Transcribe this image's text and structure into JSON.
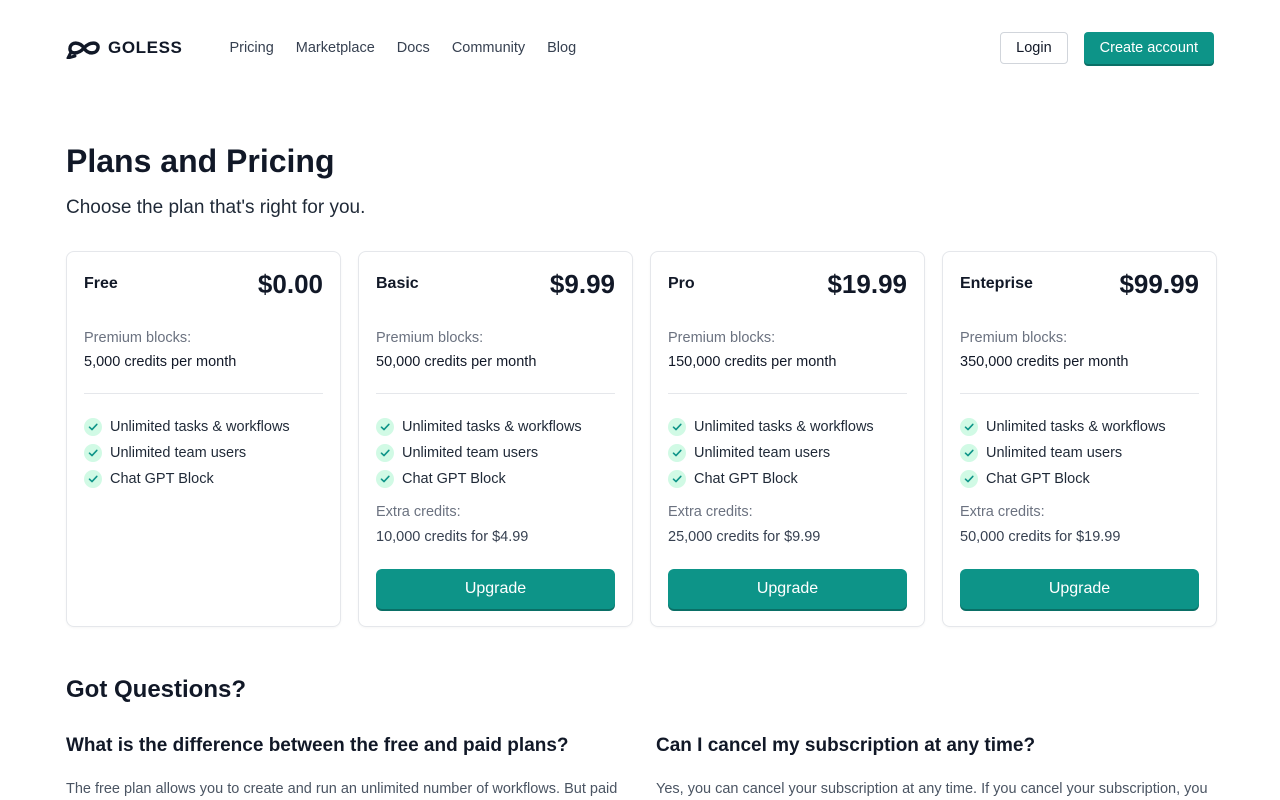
{
  "header": {
    "logo_text": "GOLESS",
    "nav": [
      "Pricing",
      "Marketplace",
      "Docs",
      "Community",
      "Blog"
    ],
    "login_label": "Login",
    "create_label": "Create account",
    "accent_color": "#0d9488"
  },
  "hero": {
    "title": "Plans and Pricing",
    "subtitle": "Choose the plan that's right for you."
  },
  "plans": [
    {
      "name": "Free",
      "price": "$0.00",
      "premium_label": "Premium blocks:",
      "credits": "5,000 credits per month",
      "features": [
        "Unlimited tasks & workflows",
        "Unlimited team users",
        "Chat GPT Block"
      ]
    },
    {
      "name": "Basic",
      "price": "$9.99",
      "premium_label": "Premium blocks:",
      "credits": "50,000 credits per month",
      "features": [
        "Unlimited tasks & workflows",
        "Unlimited team users",
        "Chat GPT Block"
      ],
      "extra_label": "Extra credits:",
      "extra_value": "10,000 credits for $4.99",
      "button_label": "Upgrade"
    },
    {
      "name": "Pro",
      "price": "$19.99",
      "premium_label": "Premium blocks:",
      "credits": "150,000 credits per month",
      "features": [
        "Unlimited tasks & workflows",
        "Unlimited team users",
        "Chat GPT Block"
      ],
      "extra_label": "Extra credits:",
      "extra_value": "25,000 credits for $9.99",
      "button_label": "Upgrade"
    },
    {
      "name": "Enteprise",
      "price": "$99.99",
      "premium_label": "Premium blocks:",
      "credits": "350,000 credits per month",
      "features": [
        "Unlimited tasks & workflows",
        "Unlimited team users",
        "Chat GPT Block"
      ],
      "extra_label": "Extra credits:",
      "extra_value": "50,000 credits for $19.99",
      "button_label": "Upgrade"
    }
  ],
  "faq": {
    "title": "Got Questions?",
    "items": [
      {
        "question": "What is the difference between the free and paid plans?",
        "answer": "The free plan allows you to create and run an unlimited number of workflows. But paid"
      },
      {
        "question": "Can I cancel my subscription at any time?",
        "answer": "Yes, you can cancel your subscription at any time. If you cancel your subscription, you"
      }
    ]
  }
}
